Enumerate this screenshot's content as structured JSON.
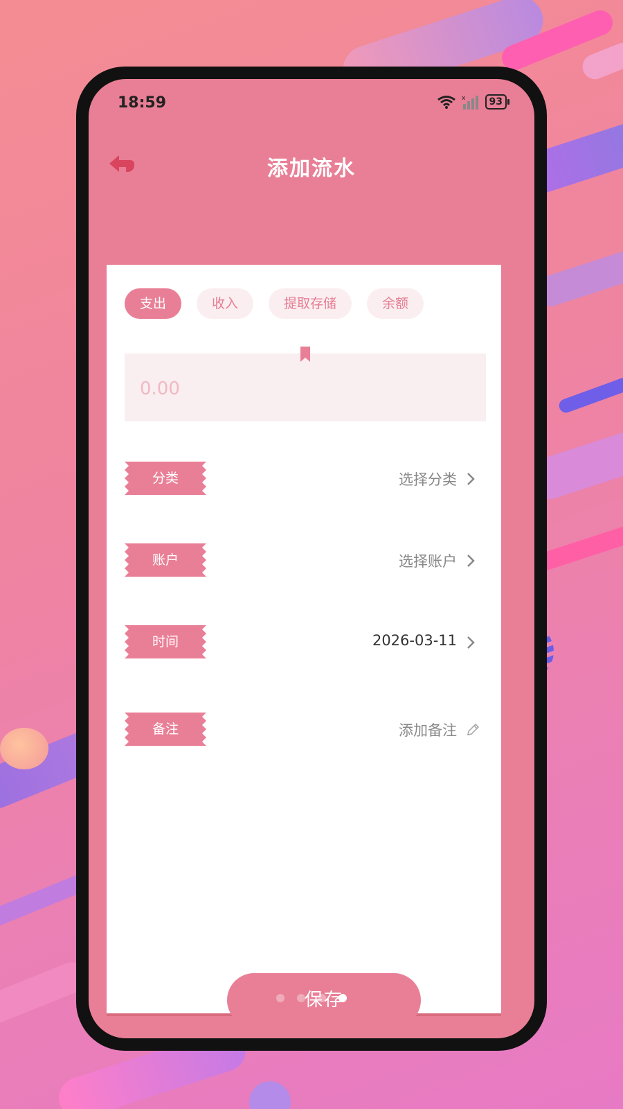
{
  "status_bar": {
    "time": "18:59",
    "battery": "93",
    "icons": [
      "wifi-icon",
      "signal-icon",
      "battery-icon"
    ]
  },
  "nav": {
    "title": "添加流水",
    "back_icon": "back-arrow-icon"
  },
  "tabs": [
    {
      "label": "支出",
      "active": true
    },
    {
      "label": "收入",
      "active": false
    },
    {
      "label": "提取存储",
      "active": false
    },
    {
      "label": "余额",
      "active": false
    }
  ],
  "amount": {
    "placeholder": "0.00"
  },
  "fields": {
    "category": {
      "label": "分类",
      "value": "选择分类",
      "icon": "chevron-right-icon"
    },
    "account": {
      "label": "账户",
      "value": "选择账户",
      "icon": "chevron-right-icon"
    },
    "date": {
      "label": "时间",
      "value": "2026-03-11",
      "icon": "chevron-right-icon"
    },
    "note": {
      "label": "备注",
      "value": "添加备注",
      "icon": "pencil-icon"
    }
  },
  "save_button": {
    "label": "保存"
  },
  "pager": {
    "count": 4,
    "active_index": 3
  },
  "colors": {
    "accent": "#e97f96",
    "tab_inactive_bg": "#fbeef0",
    "amount_bg": "#f9eef0",
    "card_bg": "#ffffff"
  }
}
